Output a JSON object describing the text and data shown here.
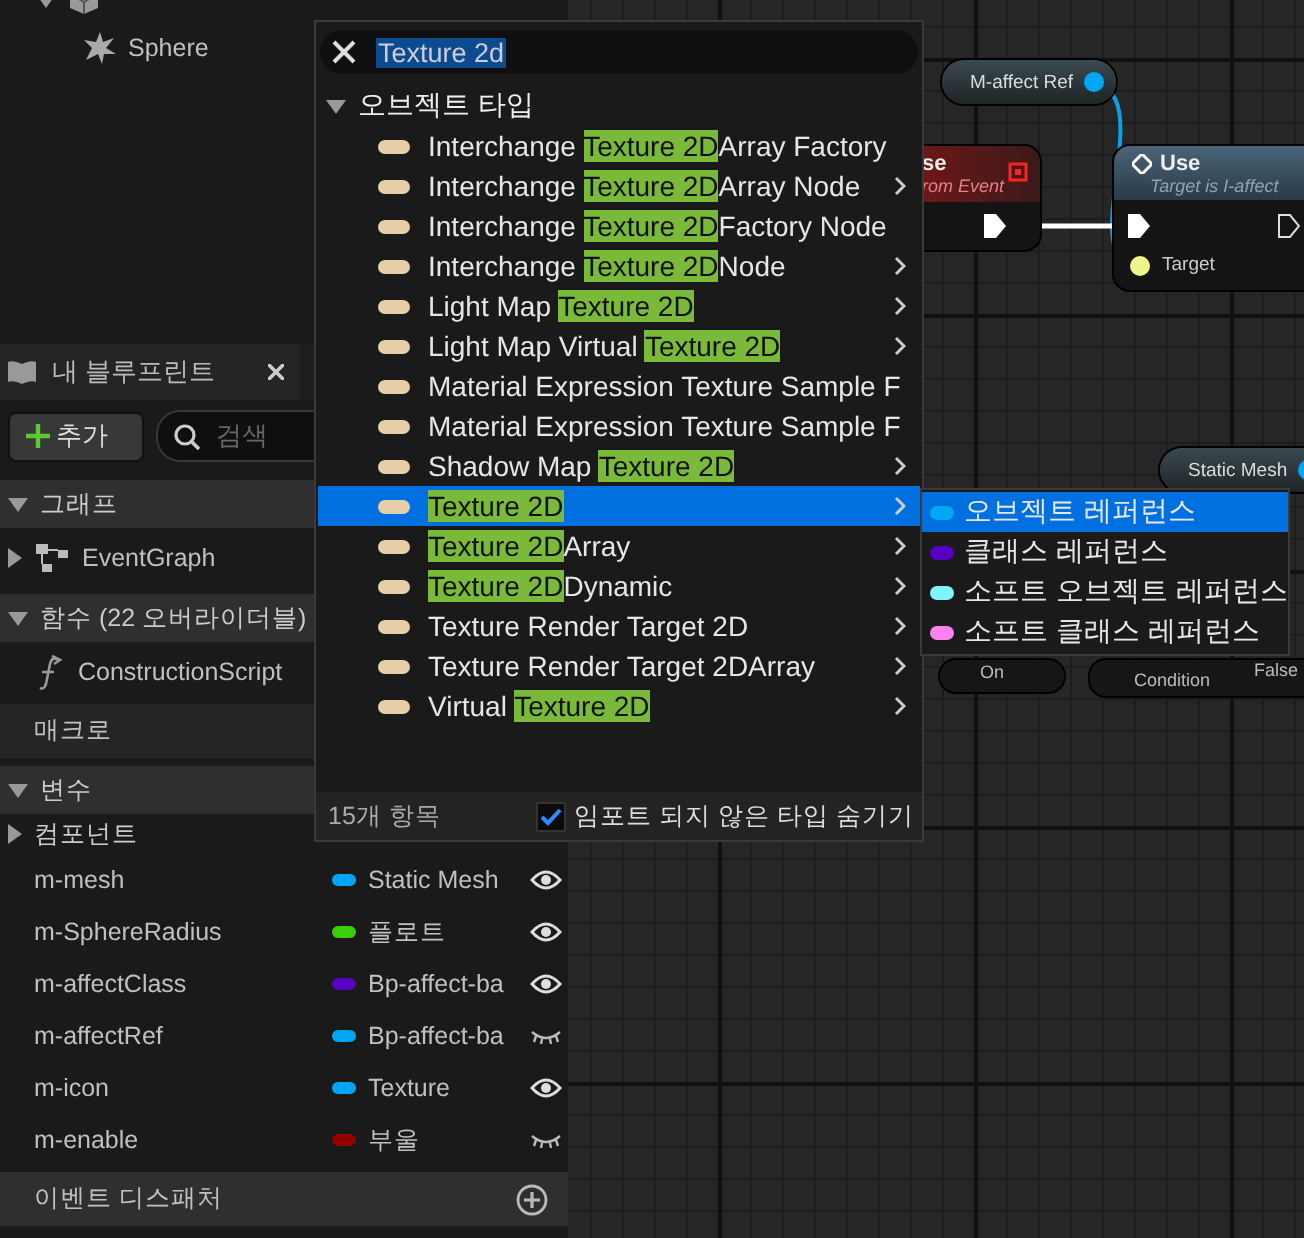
{
  "outliner": {
    "items": [
      {
        "kind": "mesh"
      },
      {
        "label": "Sphere",
        "kind": "sphere"
      }
    ]
  },
  "my_blueprint": {
    "title": "내 블루프린트",
    "add_button": "추가",
    "search": {
      "placeholder": "검색"
    },
    "rows": [
      {
        "kind": "header",
        "label": "그래프",
        "expanded": true
      },
      {
        "kind": "graph",
        "label": "EventGraph"
      },
      {
        "kind": "header",
        "label": "함수 (22 오버라이더블)",
        "expanded": true
      },
      {
        "kind": "function",
        "label": "ConstructionScript"
      },
      {
        "kind": "plain",
        "label": "매크로"
      },
      {
        "kind": "header",
        "label": "변수",
        "expanded": true
      },
      {
        "kind": "category",
        "label": "컴포넌트",
        "expanded": false
      }
    ],
    "variables": [
      {
        "name": "m-mesh",
        "type": "Static Mesh",
        "color": "#00a8f4",
        "public": true
      },
      {
        "name": "m-SphereRadius",
        "type": "플로트",
        "color": "#3acf0e",
        "public": true
      },
      {
        "name": "m-affectClass",
        "type": "Bp-affect-ba",
        "color": "#5a00c0",
        "public": true
      },
      {
        "name": "m-affectRef",
        "type": "Bp-affect-ba",
        "color": "#00a8f4",
        "public": false
      },
      {
        "name": "m-icon",
        "type": "Texture",
        "color": "#00a8f4",
        "public": true
      },
      {
        "name": "m-enable",
        "type": "부울",
        "color": "#920101",
        "public": false
      }
    ],
    "event_dispatchers": {
      "label": "이벤트 디스패처"
    }
  },
  "graph": {
    "nodes": [
      {
        "kind": "getter",
        "title": "M-affect Ref"
      },
      {
        "kind": "event",
        "title": "se",
        "subtitle": "rom Event"
      },
      {
        "kind": "function",
        "title": "Use",
        "subtitle": "Target is I-affect",
        "pin": "Target"
      },
      {
        "kind": "getter",
        "title": "Static Mesh"
      },
      {
        "kind": "pin_row",
        "title": "On"
      },
      {
        "kind": "branch",
        "title": "Condition",
        "pin": "False"
      }
    ]
  },
  "type_menu": {
    "search": {
      "value": "Texture 2d"
    },
    "category": {
      "label": "오브젝트 타입",
      "expanded": true
    },
    "items": [
      {
        "before": "Interchange ",
        "match": "Texture 2D",
        "after": "Array Factory",
        "submenu": false,
        "selected": false
      },
      {
        "before": "Interchange ",
        "match": "Texture 2D",
        "after": "Array Node",
        "submenu": true,
        "selected": false
      },
      {
        "before": "Interchange ",
        "match": "Texture 2D",
        "after": "Factory Node",
        "submenu": false,
        "selected": false
      },
      {
        "before": "Interchange ",
        "match": "Texture 2D",
        "after": "Node",
        "submenu": true,
        "selected": false
      },
      {
        "before": "Light Map ",
        "match": "Texture 2D",
        "submenu": true,
        "selected": false
      },
      {
        "before": "Light Map Virtual ",
        "match": "Texture 2D",
        "submenu": true,
        "selected": false
      },
      {
        "before": "Material Expression Texture Sample F",
        "submenu": false,
        "selected": false
      },
      {
        "before": "Material Expression Texture Sample F",
        "submenu": false,
        "selected": false
      },
      {
        "before": "Shadow Map ",
        "match": "Texture 2D",
        "submenu": true,
        "selected": false
      },
      {
        "match": "Texture 2D",
        "submenu": true,
        "selected": true
      },
      {
        "match": "Texture 2D",
        "after": "Array",
        "submenu": true,
        "selected": false
      },
      {
        "match": "Texture 2D",
        "after": "Dynamic",
        "submenu": true,
        "selected": false
      },
      {
        "before": "Texture Render Target 2D",
        "submenu": true,
        "selected": false
      },
      {
        "before": "Texture Render Target 2DArray",
        "submenu": true,
        "selected": false
      },
      {
        "before": "Virtual ",
        "match": "Texture 2D",
        "submenu": true,
        "selected": false
      }
    ],
    "footer": {
      "count": "15개 항목",
      "checkbox": {
        "label": "임포트 되지 않은 타입 숨기기",
        "checked": true
      }
    }
  },
  "reference_menu": {
    "items": [
      {
        "label": "오브젝트 레퍼런스",
        "color": "#00a8f4",
        "selected": true
      },
      {
        "label": "클래스 레퍼런스",
        "color": "#5a00c0",
        "selected": false
      },
      {
        "label": "소프트 오브젝트 레퍼런스",
        "color": "#7ef4ff",
        "selected": false
      },
      {
        "label": "소프트 클래스 레퍼런스",
        "color": "#ff80f0",
        "selected": false
      }
    ]
  }
}
